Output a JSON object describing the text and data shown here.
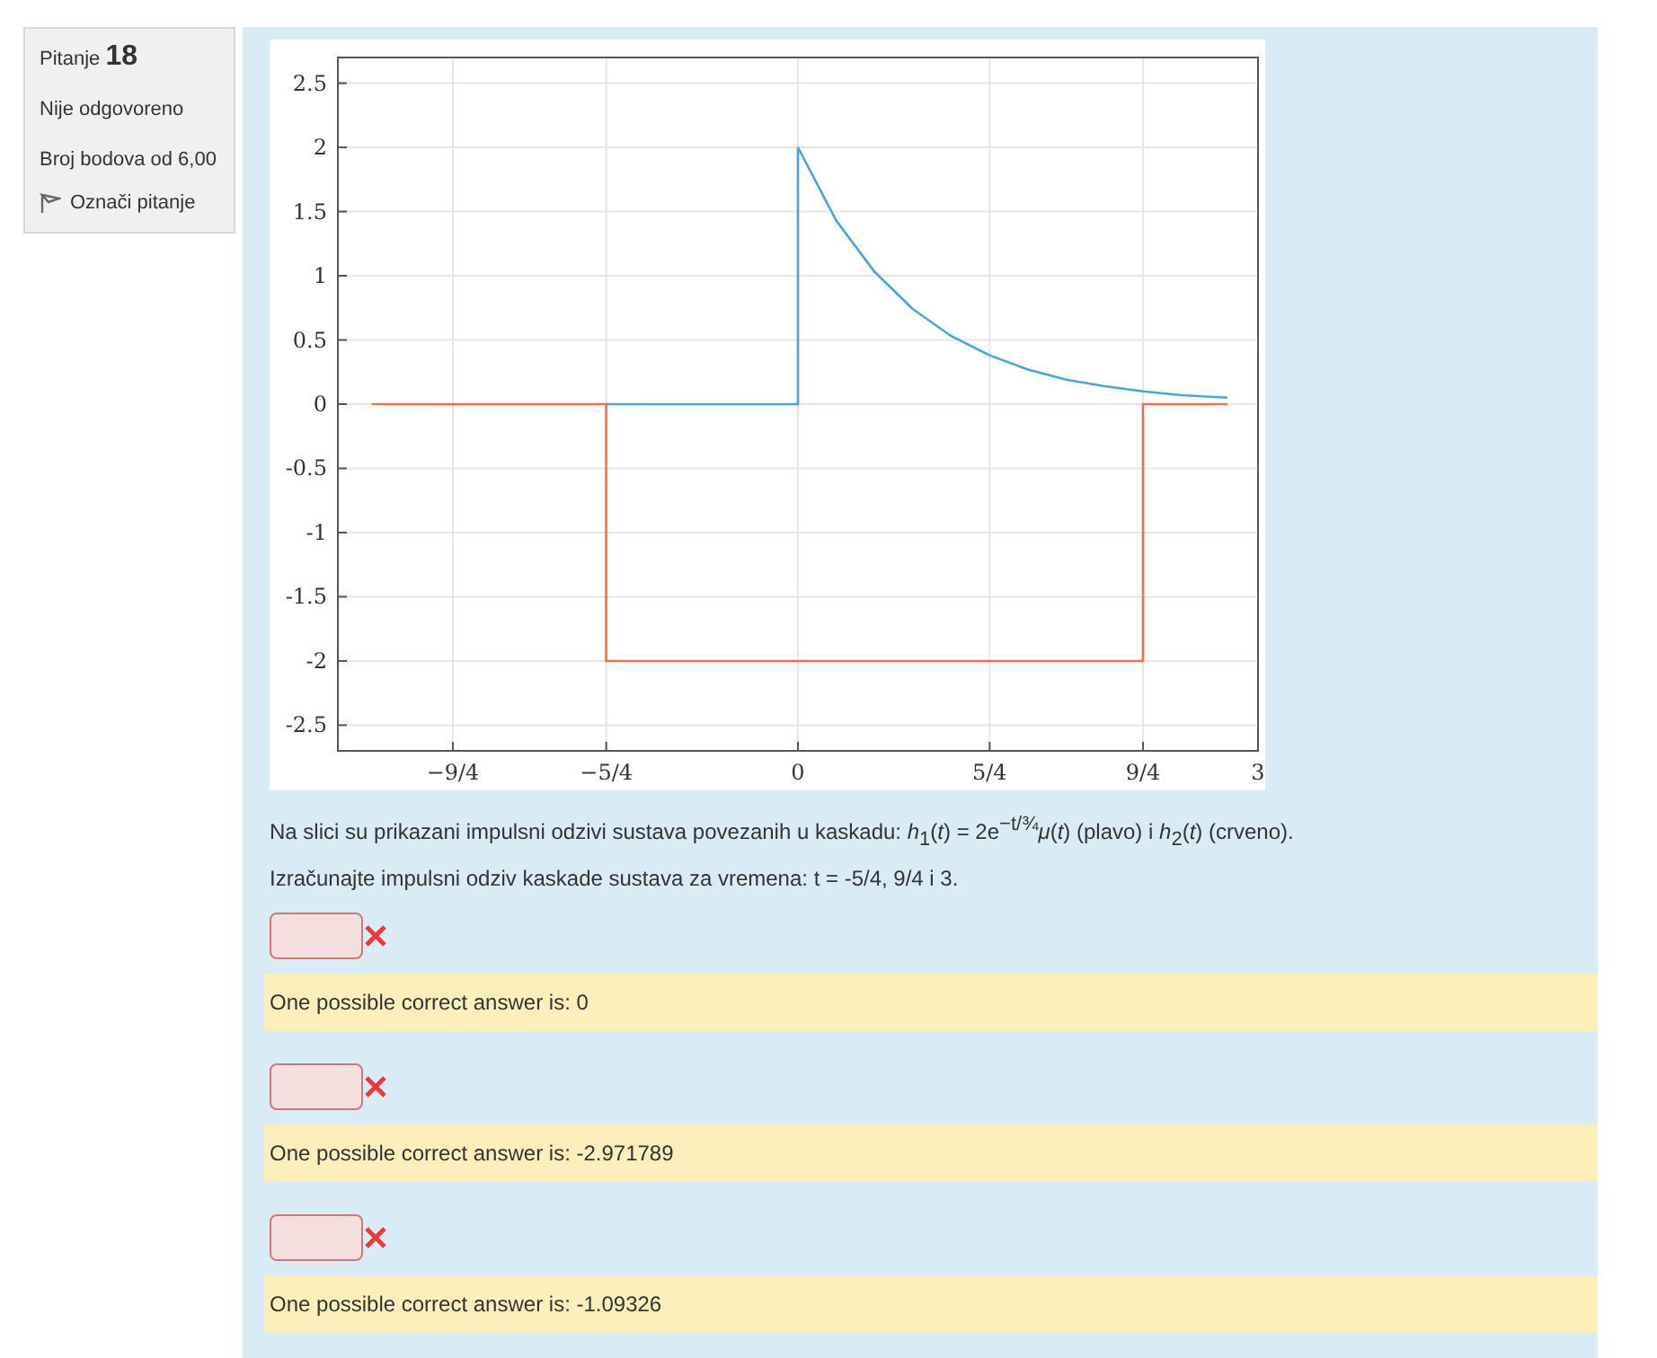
{
  "question_info": {
    "label": "Pitanje",
    "number": "18",
    "state": "Nije odgovoreno",
    "marks": "Broj bodova od 6,00",
    "flag": "Označi pitanje"
  },
  "chart": {
    "chart_data": {
      "type": "line",
      "x": [
        -2.78,
        -1.25,
        -1.25,
        0,
        0,
        0.25,
        0.5,
        0.75,
        1,
        1.25,
        1.5,
        1.75,
        2,
        2.25,
        2.25,
        2.5,
        2.8
      ],
      "series": [
        {
          "color": "#4aa3df",
          "values": [
            null,
            null,
            0,
            0,
            2,
            1.43,
            1.03,
            0.74,
            0.53,
            0.38,
            0.27,
            0.19,
            0.14,
            0.1,
            0.1,
            0.07,
            0.05
          ]
        },
        {
          "color": "#e8744f",
          "values": [
            0,
            0,
            -2,
            -2,
            -2,
            -2,
            -2,
            -2,
            -2,
            -2,
            -2,
            -2,
            -2,
            -2,
            0,
            0,
            0
          ]
        }
      ],
      "xlim": [
        -3,
        3
      ],
      "ylim": [
        -2.7,
        2.7
      ],
      "grid": true,
      "xticks": [
        {
          "value": -2.25,
          "label": "−9/4"
        },
        {
          "value": -1.25,
          "label": "−5/4"
        },
        {
          "value": 0,
          "label": "0"
        },
        {
          "value": 1.25,
          "label": "5/4"
        },
        {
          "value": 2.25,
          "label": "9/4"
        },
        {
          "value": 3,
          "label": "3"
        }
      ],
      "yticks": [
        {
          "value": 2.5,
          "label": "2.5"
        },
        {
          "value": 2,
          "label": "2"
        },
        {
          "value": 1.5,
          "label": "1.5"
        },
        {
          "value": 1,
          "label": "1"
        },
        {
          "value": 0.5,
          "label": "0.5"
        },
        {
          "value": 0,
          "label": "0"
        },
        {
          "value": -0.5,
          "label": "-0.5"
        },
        {
          "value": -1,
          "label": "-1"
        },
        {
          "value": -1.5,
          "label": "-1.5"
        },
        {
          "value": -2,
          "label": "-2"
        },
        {
          "value": -2.5,
          "label": "-2.5"
        }
      ]
    }
  },
  "question_text": "Na slici su prikazani impulsni odzivi sustava povezanih u kaskadu: *h*$_{1}$(*t*) = 2e$^{−t/¾}$*μ*(*t*) (plavo) i *h*$_{2}$(*t*) (crveno).",
  "instruction": "Izračunajte impulsni odziv kaskade sustava za vremena: t = -5/4, 9/4 i 3.",
  "answers": [
    {
      "correct": false,
      "feedback": "One possible correct answer is: 0"
    },
    {
      "correct": false,
      "feedback": "One possible correct answer is: -2.971789"
    },
    {
      "correct": false,
      "feedback": "One possible correct answer is: -1.09326"
    }
  ]
}
